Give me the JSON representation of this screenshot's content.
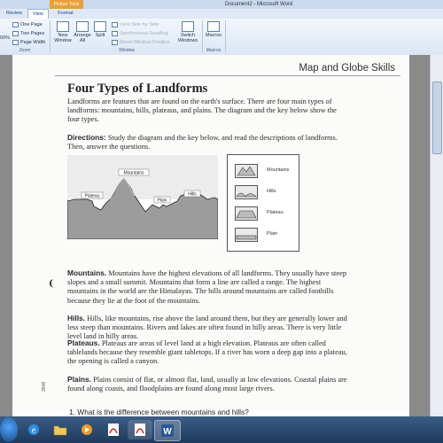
{
  "window": {
    "title": "Document2 - Microsoft Word"
  },
  "ribbon": {
    "contextual_tab": "Picture Tools",
    "tabs": [
      {
        "label": "Review",
        "active": false
      },
      {
        "label": "View",
        "active": true
      },
      {
        "label": "Format",
        "active": false
      }
    ],
    "zoom_group": {
      "label": "Zoom",
      "zoom_value": "00%",
      "one_page": "One Page",
      "two_pages": "Two Pages",
      "page_width": "Page Width"
    },
    "window_group": {
      "label": "Window",
      "new_window": [
        "New",
        "Window"
      ],
      "arrange_all": [
        "Arrange",
        "All"
      ],
      "split": "Split",
      "view_side_by_side": "View Side by Side",
      "sync_scrolling": "Synchronous Scrolling",
      "reset_window_position": "Reset Window Position",
      "switch_windows": [
        "Switch",
        "Windows"
      ]
    },
    "macros_group": {
      "label": "Macros",
      "macros": "Macros"
    }
  },
  "document": {
    "header": "Map and Globe Skills",
    "title": "Four Types of Landforms",
    "intro": "Landforms are features that are found on the earth's surface. There are four main types of landforms: mountains, hills, plateaus, and plains. The diagram and the key below show the four types.",
    "directions_label": "Directions:",
    "directions": "Study the diagram and the key below, and read the descriptions of landforms. Then, answer the questions.",
    "diagram_labels": {
      "mountains": "Mountains",
      "plateau": "Plateau",
      "plain": "Plain",
      "hills": "Hills"
    },
    "key": [
      "Mountains",
      "Hills",
      "Plateau",
      "Plain"
    ],
    "paragraphs": [
      {
        "term": "Mountains.",
        "text": "Mountains have the highest elevations of all landforms. They usually have steep slopes and a small summit. Mountains that form a line are called a range. The highest mountains in the world are the Himalayas. The hills around mountains are called foothills because they lie at the foot of the mountains."
      },
      {
        "term": "Hills.",
        "text": "Hills, like mountains, rise above the land around them, but they are generally lower and less steep than mountains. Rivers and lakes are often found in hilly areas. There is very little level land in hilly areas."
      },
      {
        "term": "Plateaus.",
        "text": "Plateaus are areas of level land at a high elevation. Plateaus are often called tablelands because they resemble giant tabletops. If a river has worn a deep gap into a plateau, the opening is called a canyon."
      },
      {
        "term": "Plains.",
        "text": "Plains consist of flat, or almost flat, land, usually at low elevations. Coastal plains are found along coasts, and floodplains are found along most large rivers."
      }
    ],
    "question": "1.  What is the difference between mountains and hills?",
    "side_code": "3548"
  },
  "taskbar": {
    "items": [
      "internet-explorer-icon",
      "folder-icon",
      "media-player-icon",
      "pdf-icon",
      "pdf-icon",
      "word-icon"
    ]
  }
}
